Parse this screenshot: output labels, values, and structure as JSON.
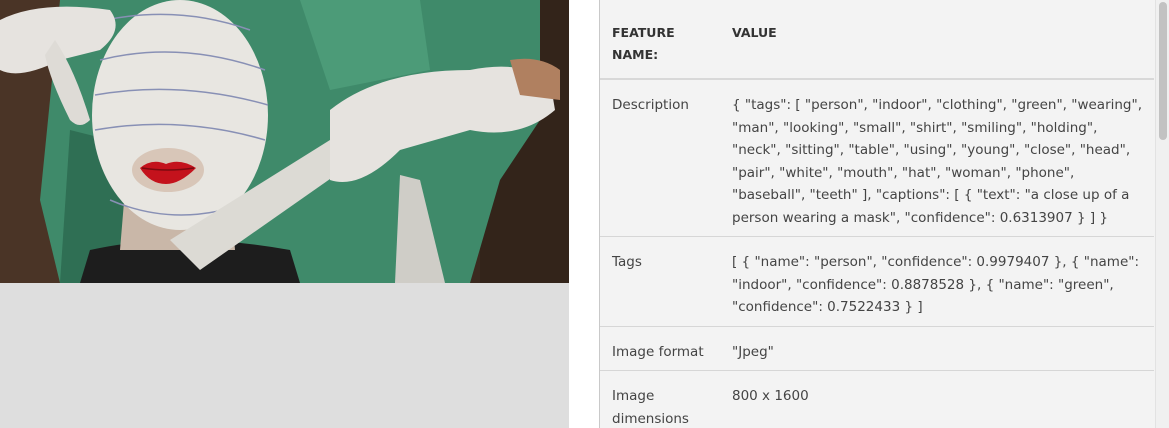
{
  "table": {
    "headers": {
      "name": "FEATURE NAME:",
      "value": "VALUE"
    },
    "rows": [
      {
        "name": "Description",
        "value": "{ \"tags\": [ \"person\", \"indoor\", \"clothing\", \"green\", \"wearing\", \"man\", \"looking\", \"small\", \"shirt\", \"smiling\", \"holding\", \"neck\", \"sitting\", \"table\", \"using\", \"young\", \"close\", \"head\", \"pair\", \"white\", \"mouth\", \"hat\", \"woman\", \"phone\", \"baseball\", \"teeth\" ], \"captions\": [ { \"text\": \"a close up of a person wearing a mask\", \"confidence\": 0.6313907 } ] }"
      },
      {
        "name": "Tags",
        "value": "[ { \"name\": \"person\", \"confidence\": 0.9979407 }, { \"name\": \"indoor\", \"confidence\": 0.8878528 }, { \"name\": \"green\", \"confidence\": 0.7522433 } ]"
      },
      {
        "name": "Image format",
        "value": "\"Jpeg\""
      },
      {
        "name": "Image dimensions",
        "value": "800 x 1600"
      }
    ]
  },
  "colors": {
    "panel_bg": "#f3f3f3",
    "image_bg": "#dedede",
    "scrubs_green": "#3f8a6a",
    "lips_red": "#c4121c"
  }
}
